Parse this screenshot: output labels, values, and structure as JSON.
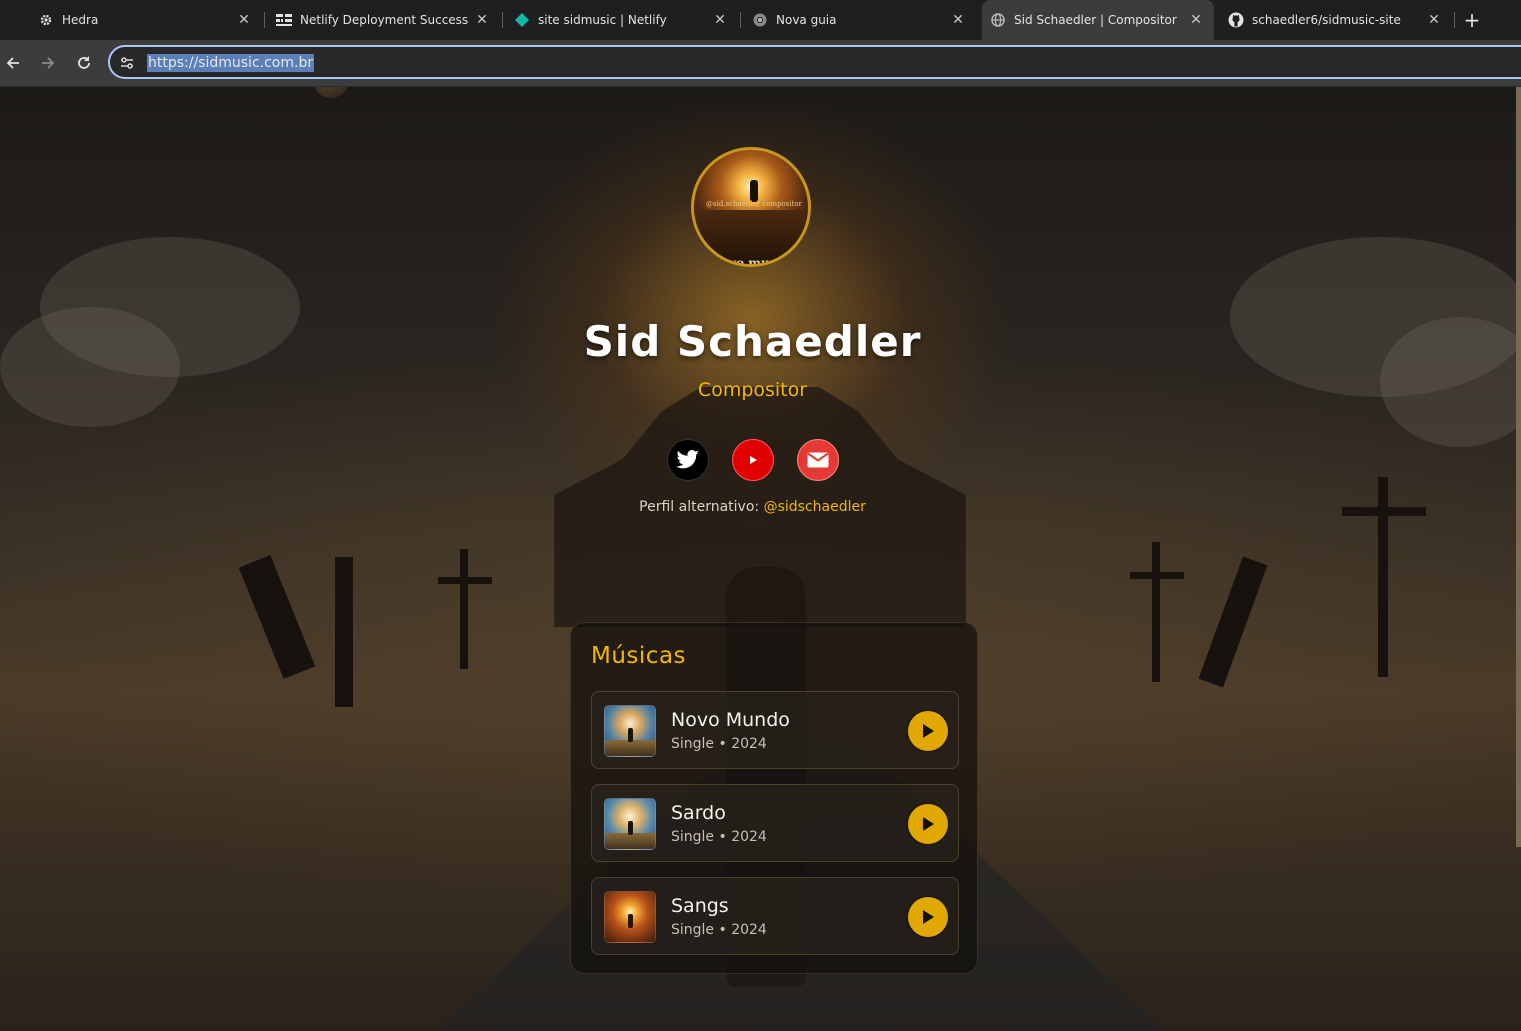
{
  "browser": {
    "tabs": [
      {
        "title": "Hedra",
        "icon": "hedra-gear-icon",
        "active": false
      },
      {
        "title": "Netlify Deployment Success - S",
        "icon": "netlify-logo-icon",
        "active": false
      },
      {
        "title": "site sidmusic | Netlify",
        "icon": "netlify-diamond-icon",
        "active": false
      },
      {
        "title": "Nova guia",
        "icon": "chrome-icon",
        "active": false
      },
      {
        "title": "Sid Schaedler | Compositor",
        "icon": "globe-icon",
        "active": true
      },
      {
        "title": "schaedler6/sidmusic-site",
        "icon": "github-icon",
        "active": false
      }
    ],
    "new_tab": "+",
    "url": "https://sidmusic.com.br"
  },
  "profile": {
    "avatar_caption": "@sid.schaedler compositor",
    "avatar_word": "ovo mund",
    "name": "Sid Schaedler",
    "role": "Compositor",
    "social": [
      {
        "name": "twitter",
        "icon": "twitter-bird-icon",
        "color": "#000000"
      },
      {
        "name": "youtube",
        "icon": "youtube-play-icon",
        "color": "#e00000"
      },
      {
        "name": "email",
        "icon": "envelope-icon",
        "color": "#e53935"
      }
    ],
    "alt_label": "Perfil alternativo: ",
    "alt_handle": "@sidschaedler"
  },
  "music": {
    "title": "Músicas",
    "tracks": [
      {
        "title": "Novo Mundo",
        "subtitle": "Single • 2024"
      },
      {
        "title": "Sardo",
        "subtitle": "Single • 2024"
      },
      {
        "title": "Sangs",
        "subtitle": "Single • 2024"
      }
    ]
  },
  "colors": {
    "accent": "#f2b705",
    "play_button": "#e0a800",
    "omnibox_focus": "#a8c7fa"
  }
}
